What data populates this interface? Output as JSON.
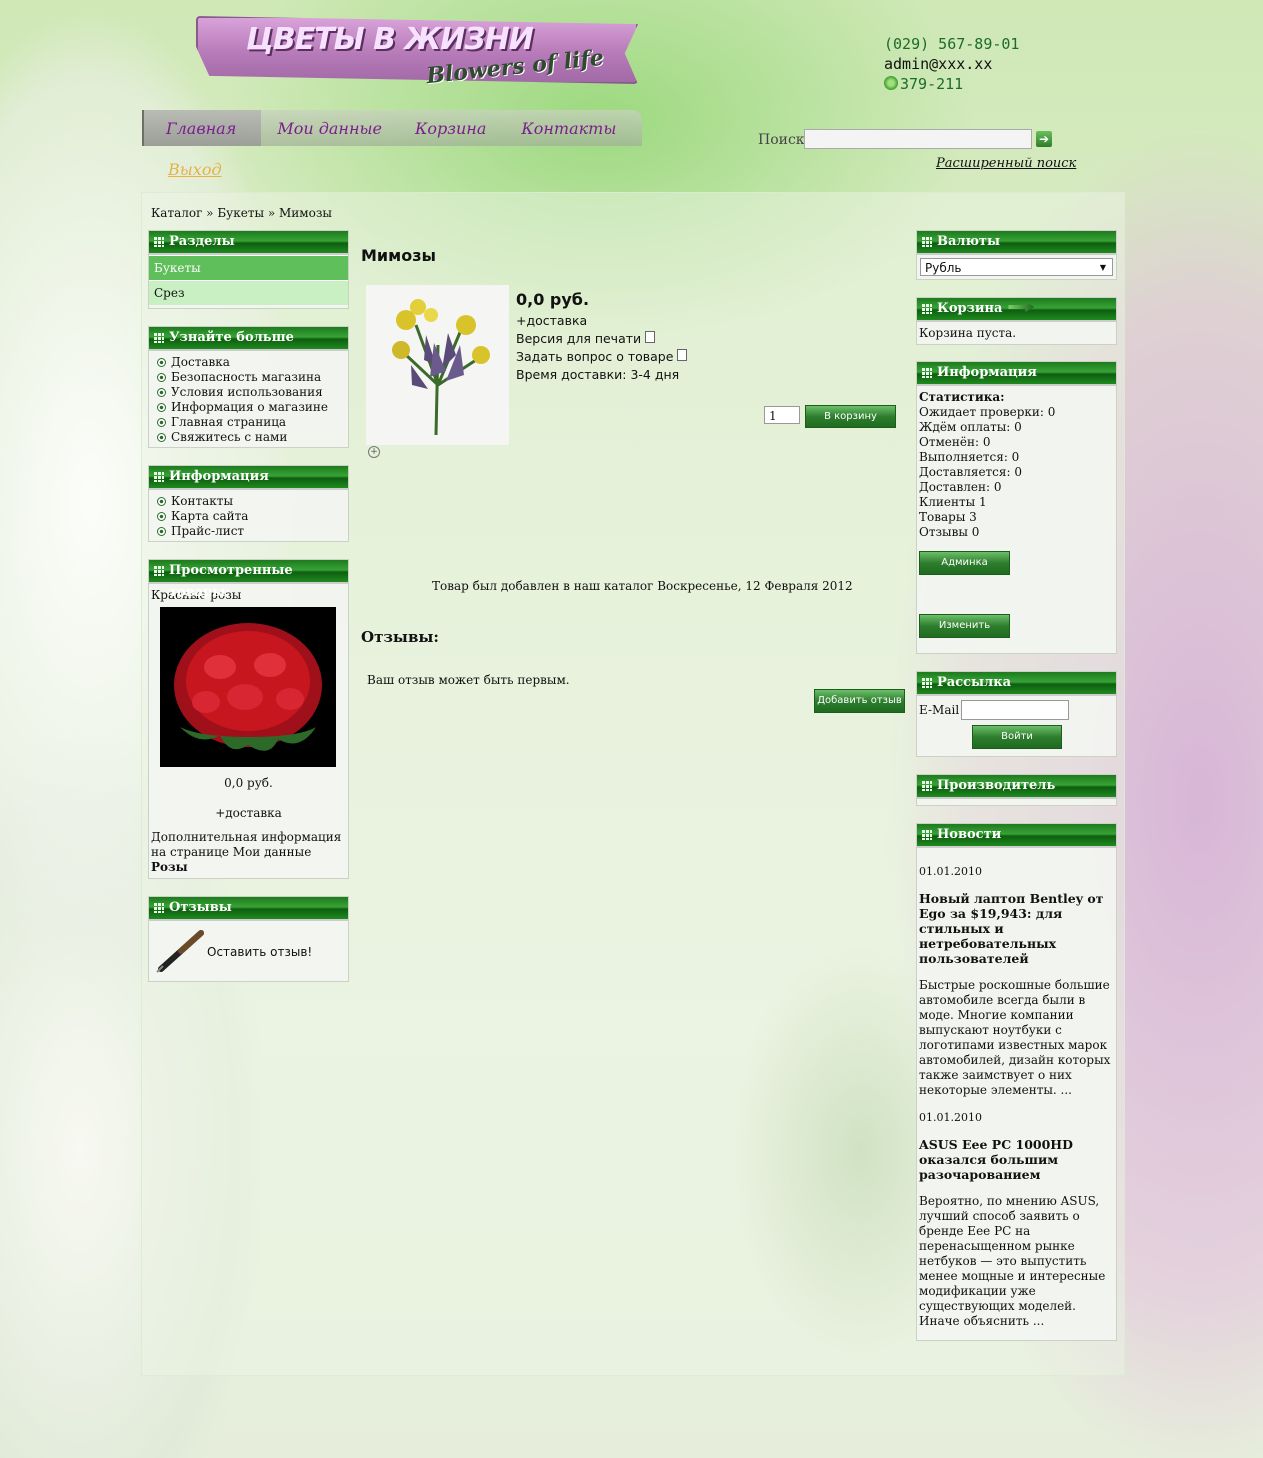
{
  "logo": {
    "title_ru": "ЦВЕТЫ В ЖИЗНИ",
    "title_en": "Blowers of life"
  },
  "contacts": {
    "phone": "(029) 567-89-01",
    "email": "admin@xxx.xx",
    "icq": "379-211"
  },
  "nav": {
    "items": [
      "Главная",
      "Мои данные",
      "Корзина",
      "Контакты"
    ],
    "logout": "Выход"
  },
  "search": {
    "label": "Поиск",
    "value": "",
    "advanced": "Расширенный поиск"
  },
  "breadcrumb": "Каталог » Букеты » Мимозы",
  "left": {
    "sections_title": "Разделы",
    "sections": [
      "Букеты",
      "Срез"
    ],
    "learn_title": "Узнайте больше",
    "learn_items": [
      "Доставка",
      "Безопасность магазина",
      "Условия использования",
      "Информация о магазине",
      "Главная страница",
      "Свяжитесь с нами"
    ],
    "info_title": "Информация",
    "info_items": [
      "Контакты",
      "Карта сайта",
      "Прайс-лист"
    ],
    "viewed_title": "Просмотренные товары:",
    "viewed_name": "Красные розы",
    "viewed_price": "0,0 руб.",
    "viewed_delivery": "+доставка",
    "viewed_note": "Дополнительная информация на странице Мои данные",
    "viewed_category": "Розы",
    "reviews_title": "Отзывы",
    "reviews_link": "Оставить отзыв!"
  },
  "product": {
    "title": "Мимозы",
    "price": "0,0 руб.",
    "delivery": "+доставка",
    "print": "Версия для печати",
    "ask": "Задать вопрос о товаре",
    "time": "Время доставки: 3-4 дня",
    "qty": "1",
    "cart_button": "В корзину",
    "added": "Товар был добавлен в наш каталог Воскресенье, 12 Февраля 2012",
    "reviews_title": "Отзывы:",
    "review_first": "Ваш отзыв может быть первым.",
    "add_review": "Добавить отзыв"
  },
  "right": {
    "currency_title": "Валюты",
    "currency": "Рубль",
    "cart_title": "Корзина",
    "cart_empty": "Корзина пуста.",
    "info_title": "Информация",
    "stats_title": "Статистика:",
    "stats": [
      "Ожидает проверки: 0",
      "Ждём оплаты: 0",
      "Отменён: 0",
      "Выполняется: 0",
      "Доставляется: 0",
      "Доставлен: 0",
      "Клиенты 1",
      "Товары 3",
      "Отзывы 0"
    ],
    "admin_button": "Админка",
    "edit_button": "Изменить",
    "newsletter_title": "Рассылка",
    "email_label": "E-Mail",
    "login_button": "Войти",
    "manufacturer_title": "Производитель",
    "news_title": "Новости",
    "news": [
      {
        "date": "01.01.2010",
        "title": "Новый лаптоп Bentley от Ego за $19,943: для стильных и нетребовательных пользователей",
        "text": "Быстрые роскошные большие автомобиле всегда были в моде. Многие компании выпускают ноутбуки с логотипами известных марок автомобилей, дизайн которых также заимствует о них некоторые элементы. ..."
      },
      {
        "date": "01.01.2010",
        "title": "ASUS Eee PC 1000HD оказался большим разочарованием",
        "text": "Вероятно, по мнению ASUS, лучший способ заявить о бренде Eee PC на перенасыщенном рынке нетбуков — это выпустить менее мощные и интересные модификации уже существующих моделей. Иначе объяснить ..."
      }
    ]
  }
}
